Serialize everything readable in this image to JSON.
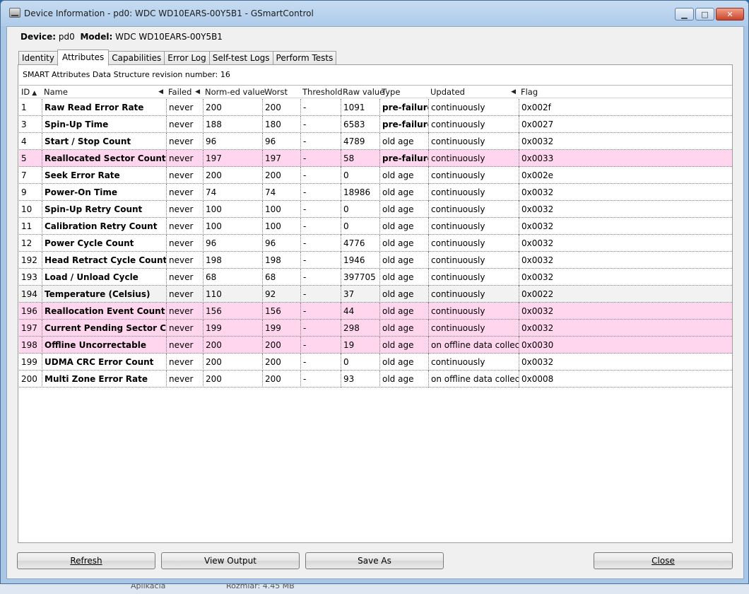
{
  "window": {
    "title": "Device Information - pd0: WDC WD10EARS-00Y5B1 - GSmartControl",
    "buttons": {
      "minimize": "▁",
      "maximize": "□",
      "close": "✕"
    }
  },
  "device": {
    "device_label": "Device:",
    "device_value": "pd0",
    "model_label": "Model:",
    "model_value": "WDC WD10EARS-00Y5B1"
  },
  "tabs": [
    {
      "label": "Identity"
    },
    {
      "label": "Attributes"
    },
    {
      "label": "Capabilities"
    },
    {
      "label": "Error Log"
    },
    {
      "label": "Self-test Logs"
    },
    {
      "label": "Perform Tests"
    }
  ],
  "revision_text": "SMART Attributes Data Structure revision number: 16",
  "columns": [
    {
      "label": "ID",
      "sort": "▲"
    },
    {
      "label": "Name",
      "sort": "◀"
    },
    {
      "label": "Failed",
      "sort": "◀"
    },
    {
      "label": "Norm-ed value",
      "sort": ""
    },
    {
      "label": "Worst",
      "sort": ""
    },
    {
      "label": "Threshold",
      "sort": ""
    },
    {
      "label": "Raw value",
      "sort": ""
    },
    {
      "label": "Type",
      "sort": ""
    },
    {
      "label": "Updated",
      "sort": "◀"
    },
    {
      "label": "Flag",
      "sort": ""
    }
  ],
  "rows": [
    {
      "id": "1",
      "name": "Raw Read Error Rate",
      "failed": "never",
      "norm": "200",
      "worst": "200",
      "threshold": "-",
      "raw": "1091",
      "type": "pre-failure",
      "updated": "continuously",
      "flag": "0x002f",
      "state": "normal"
    },
    {
      "id": "3",
      "name": "Spin-Up Time",
      "failed": "never",
      "norm": "188",
      "worst": "180",
      "threshold": "-",
      "raw": "6583",
      "type": "pre-failure",
      "updated": "continuously",
      "flag": "0x0027",
      "state": "normal"
    },
    {
      "id": "4",
      "name": "Start / Stop Count",
      "failed": "never",
      "norm": "96",
      "worst": "96",
      "threshold": "-",
      "raw": "4789",
      "type": "old age",
      "updated": "continuously",
      "flag": "0x0032",
      "state": "normal"
    },
    {
      "id": "5",
      "name": "Reallocated Sector Count",
      "failed": "never",
      "norm": "197",
      "worst": "197",
      "threshold": "-",
      "raw": "58",
      "type": "pre-failure",
      "updated": "continuously",
      "flag": "0x0033",
      "state": "warn"
    },
    {
      "id": "7",
      "name": "Seek Error Rate",
      "failed": "never",
      "norm": "200",
      "worst": "200",
      "threshold": "-",
      "raw": "0",
      "type": "old age",
      "updated": "continuously",
      "flag": "0x002e",
      "state": "normal"
    },
    {
      "id": "9",
      "name": "Power-On Time",
      "failed": "never",
      "norm": "74",
      "worst": "74",
      "threshold": "-",
      "raw": "18986",
      "type": "old age",
      "updated": "continuously",
      "flag": "0x0032",
      "state": "normal"
    },
    {
      "id": "10",
      "name": "Spin-Up Retry Count",
      "failed": "never",
      "norm": "100",
      "worst": "100",
      "threshold": "-",
      "raw": "0",
      "type": "old age",
      "updated": "continuously",
      "flag": "0x0032",
      "state": "normal"
    },
    {
      "id": "11",
      "name": "Calibration Retry Count",
      "failed": "never",
      "norm": "100",
      "worst": "100",
      "threshold": "-",
      "raw": "0",
      "type": "old age",
      "updated": "continuously",
      "flag": "0x0032",
      "state": "normal"
    },
    {
      "id": "12",
      "name": "Power Cycle Count",
      "failed": "never",
      "norm": "96",
      "worst": "96",
      "threshold": "-",
      "raw": "4776",
      "type": "old age",
      "updated": "continuously",
      "flag": "0x0032",
      "state": "normal"
    },
    {
      "id": "192",
      "name": "Head Retract Cycle Count",
      "failed": "never",
      "norm": "198",
      "worst": "198",
      "threshold": "-",
      "raw": "1946",
      "type": "old age",
      "updated": "continuously",
      "flag": "0x0032",
      "state": "normal"
    },
    {
      "id": "193",
      "name": "Load / Unload Cycle",
      "failed": "never",
      "norm": "68",
      "worst": "68",
      "threshold": "-",
      "raw": "397705",
      "type": "old age",
      "updated": "continuously",
      "flag": "0x0032",
      "state": "normal"
    },
    {
      "id": "194",
      "name": "Temperature (Celsius)",
      "failed": "never",
      "norm": "110",
      "worst": "92",
      "threshold": "-",
      "raw": "37",
      "type": "old age",
      "updated": "continuously",
      "flag": "0x0022",
      "state": "alt"
    },
    {
      "id": "196",
      "name": "Reallocation Event Count",
      "failed": "never",
      "norm": "156",
      "worst": "156",
      "threshold": "-",
      "raw": "44",
      "type": "old age",
      "updated": "continuously",
      "flag": "0x0032",
      "state": "warn"
    },
    {
      "id": "197",
      "name": "Current Pending Sector Count",
      "failed": "never",
      "norm": "199",
      "worst": "199",
      "threshold": "-",
      "raw": "298",
      "type": "old age",
      "updated": "continuously",
      "flag": "0x0032",
      "state": "warn"
    },
    {
      "id": "198",
      "name": "Offline Uncorrectable",
      "failed": "never",
      "norm": "200",
      "worst": "200",
      "threshold": "-",
      "raw": "19",
      "type": "old age",
      "updated": "on offline data collect.",
      "flag": "0x0030",
      "state": "warn"
    },
    {
      "id": "199",
      "name": "UDMA CRC Error Count",
      "failed": "never",
      "norm": "200",
      "worst": "200",
      "threshold": "-",
      "raw": "0",
      "type": "old age",
      "updated": "continuously",
      "flag": "0x0032",
      "state": "normal"
    },
    {
      "id": "200",
      "name": "Multi Zone Error Rate",
      "failed": "never",
      "norm": "200",
      "worst": "200",
      "threshold": "-",
      "raw": "93",
      "type": "old age",
      "updated": "on offline data collect.",
      "flag": "0x0008",
      "state": "normal"
    }
  ],
  "buttons": {
    "refresh": "Refresh",
    "view_output": "View Output",
    "save_as": "Save As",
    "close": "Close"
  },
  "taskbar": {
    "left_text": "Aplikacia",
    "right_text": "Rozmiar: 4.45 MB"
  },
  "colors": {
    "warn_row": "#ffd6ee",
    "alt_row": "#f2f2f2",
    "title_bar": "#aecbe9"
  }
}
